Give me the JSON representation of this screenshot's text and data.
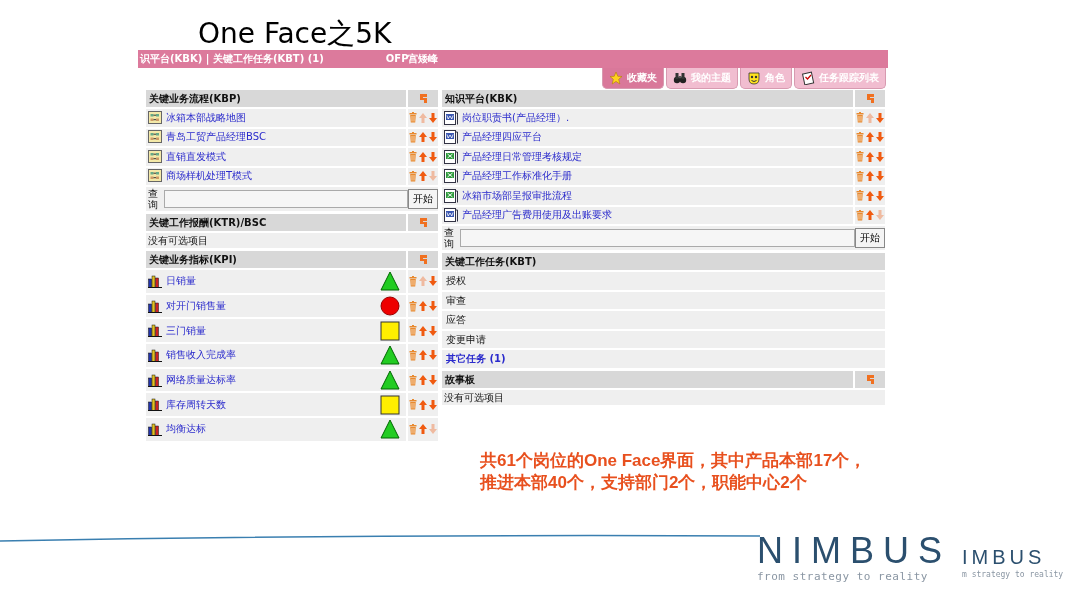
{
  "slide_title": "One Face之5K",
  "app": {
    "top_bar": {
      "path": "识平台(KBK) | 关键工作任务(KBT) (1)",
      "user": "OFP宫矮峰"
    },
    "tabs": [
      {
        "label": "收藏夹",
        "selected": true
      },
      {
        "label": "我的主题",
        "selected": false
      },
      {
        "label": "角色",
        "selected": false
      },
      {
        "label": "任务跟踪列表",
        "selected": false
      }
    ],
    "left": [
      {
        "kind": "list",
        "title": "关键业务流程(KBP)",
        "items": [
          {
            "label": "冰箱本部战略地图",
            "kind": "map",
            "up_enabled": false,
            "down_enabled": true
          },
          {
            "label": "青岛工贸产品经理BSC",
            "kind": "map",
            "up_enabled": true,
            "down_enabled": true
          },
          {
            "label": "直销直发模式",
            "kind": "map",
            "up_enabled": true,
            "down_enabled": true
          },
          {
            "label": "商场样机处理T模式",
            "kind": "map",
            "up_enabled": true,
            "down_enabled": false
          }
        ],
        "search": {
          "label": "查询",
          "button": "开始"
        }
      },
      {
        "kind": "empty",
        "title": "关键工作报酬(KTR)/BSC",
        "message": "没有可选项目"
      },
      {
        "kind": "kpi",
        "title": "关键业务指标(KPI)",
        "items": [
          {
            "label": "日销量",
            "kind": "triangle",
            "color": "#22cc22",
            "up_enabled": false,
            "down_enabled": true
          },
          {
            "label": "对开门销售量",
            "kind": "circle",
            "color": "#ee0000",
            "up_enabled": true,
            "down_enabled": true
          },
          {
            "label": "三门销量",
            "kind": "square",
            "color": "#ffee00",
            "up_enabled": true,
            "down_enabled": true
          },
          {
            "label": "销售收入完成率",
            "kind": "triangle",
            "color": "#22cc22",
            "up_enabled": true,
            "down_enabled": true
          },
          {
            "label": "网络质量达标率",
            "kind": "triangle",
            "color": "#22cc22",
            "up_enabled": true,
            "down_enabled": true
          },
          {
            "label": "库存周转天数",
            "kind": "square",
            "color": "#ffee00",
            "up_enabled": true,
            "down_enabled": true
          },
          {
            "label": "均衡达标",
            "kind": "triangle",
            "color": "#22cc22",
            "up_enabled": true,
            "down_enabled": false
          }
        ]
      }
    ],
    "right": [
      {
        "kind": "list",
        "title": "知识平台(KBK)",
        "items": [
          {
            "label": "岗位职责书(产品经理）.",
            "kind": "word",
            "up_enabled": false,
            "down_enabled": true
          },
          {
            "label": "产品经理四应平台",
            "kind": "word",
            "up_enabled": true,
            "down_enabled": true
          },
          {
            "label": "产品经理日常管理考核规定",
            "kind": "excel",
            "up_enabled": true,
            "down_enabled": true
          },
          {
            "label": "产品经理工作标准化手册",
            "kind": "excel",
            "up_enabled": true,
            "down_enabled": true
          },
          {
            "label": "冰箱市场部呈报审批流程",
            "kind": "excel",
            "up_enabled": true,
            "down_enabled": true
          },
          {
            "label": "产品经理广告费用使用及出账要求",
            "kind": "word",
            "up_enabled": true,
            "down_enabled": false
          }
        ],
        "search": {
          "label": "查询",
          "button": "开始"
        }
      },
      {
        "kind": "tasks",
        "title": "关键工作任务(KBT)",
        "items": [
          {
            "label": "授权",
            "link": false
          },
          {
            "label": "审查",
            "link": false
          },
          {
            "label": "应答",
            "link": false
          },
          {
            "label": "变更申请",
            "link": false
          },
          {
            "label": "其它任务 (1)",
            "link": true
          }
        ]
      },
      {
        "kind": "empty",
        "title": "故事板",
        "message": "没有可选项目"
      }
    ]
  },
  "note": [
    "共61个岗位的One Face界面，其中产品本部17个，",
    "推进本部40个，支持部门2个，职能中心2个"
  ],
  "logo": {
    "name": "NIMBUS",
    "tagline": "from strategy to reality",
    "ghost_name": "IMBUS",
    "ghost_tagline": "m strategy to reality"
  }
}
